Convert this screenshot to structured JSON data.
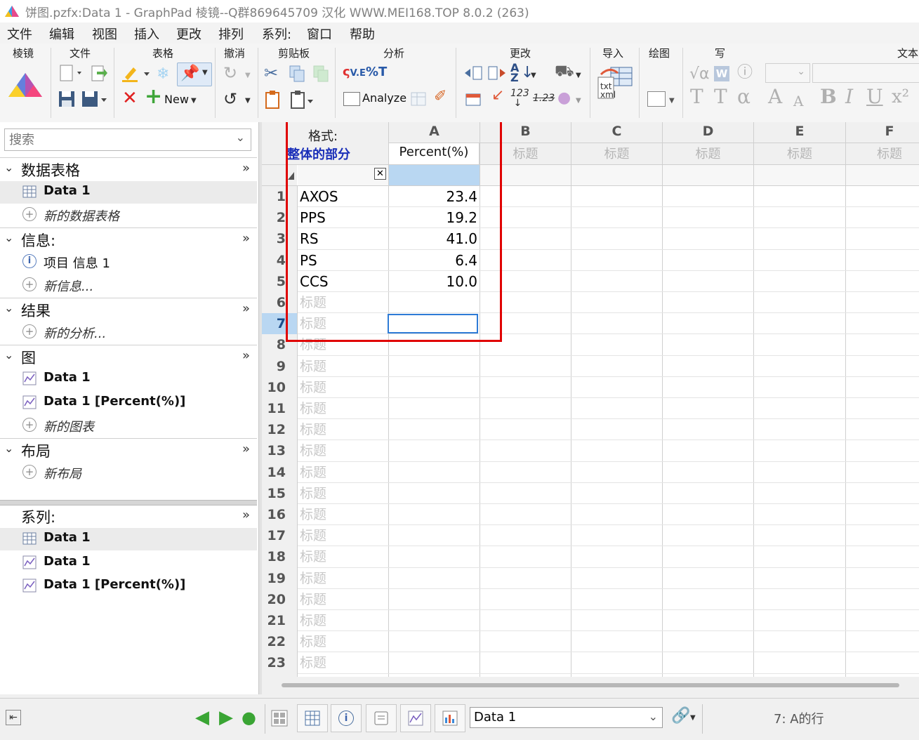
{
  "window": {
    "title": "饼图.pzfx:Data 1 - GraphPad 棱镜--Q群869645709 汉化 WWW.MEI168.TOP 8.0.2 (263)"
  },
  "menu": [
    "文件",
    "编辑",
    "视图",
    "插入",
    "更改",
    "排列",
    "系列:",
    "窗口",
    "帮助"
  ],
  "ribbon": {
    "groups": [
      "棱镜",
      "文件",
      "表格",
      "撤消",
      "剪贴板",
      "分析",
      "更改",
      "导入",
      "绘图",
      "写",
      "文本"
    ],
    "new_label": "New",
    "analyze_label": "Analyze",
    "import_label": "txt\nxml"
  },
  "navigator": {
    "search_placeholder": "搜索",
    "sections": {
      "data_tables": {
        "label": "数据表格",
        "items": [
          "Data 1"
        ],
        "new_label": "新的数据表格"
      },
      "info": {
        "label": "信息:",
        "items": [
          "项目 信息 1"
        ],
        "new_label": "新信息..."
      },
      "results": {
        "label": "结果",
        "new_label": "新的分析..."
      },
      "graphs": {
        "label": "图",
        "items": [
          "Data 1",
          "Data 1 [Percent(%)]"
        ],
        "new_label": "新的图表"
      },
      "layouts": {
        "label": "布局",
        "new_label": "新布局"
      },
      "family": {
        "label": "系列:",
        "items": [
          "Data 1",
          "Data 1",
          "Data 1 [Percent(%)]"
        ]
      }
    },
    "more_glyph": "»"
  },
  "sheet": {
    "format_label": "格式:",
    "format_value": "整体的部分",
    "columns": [
      "A",
      "B",
      "C",
      "D",
      "E",
      "F"
    ],
    "column_titles": [
      "Percent(%)",
      "标题",
      "标题",
      "标题",
      "标题",
      "标题"
    ],
    "rows": [
      {
        "n": "1",
        "title": "AXOS",
        "value": "23.4"
      },
      {
        "n": "2",
        "title": "PPS",
        "value": "19.2"
      },
      {
        "n": "3",
        "title": "RS",
        "value": "41.0"
      },
      {
        "n": "4",
        "title": "PS",
        "value": "6.4"
      },
      {
        "n": "5",
        "title": "CCS",
        "value": "10.0"
      },
      {
        "n": "6",
        "title": "标题",
        "value": ""
      },
      {
        "n": "7",
        "title": "标题",
        "value": ""
      },
      {
        "n": "8",
        "title": "标题",
        "value": ""
      },
      {
        "n": "9",
        "title": "标题",
        "value": ""
      },
      {
        "n": "10",
        "title": "标题",
        "value": ""
      },
      {
        "n": "11",
        "title": "标题",
        "value": ""
      },
      {
        "n": "12",
        "title": "标题",
        "value": ""
      },
      {
        "n": "13",
        "title": "标题",
        "value": ""
      },
      {
        "n": "14",
        "title": "标题",
        "value": ""
      },
      {
        "n": "15",
        "title": "标题",
        "value": ""
      },
      {
        "n": "16",
        "title": "标题",
        "value": ""
      },
      {
        "n": "17",
        "title": "标题",
        "value": ""
      },
      {
        "n": "18",
        "title": "标题",
        "value": ""
      },
      {
        "n": "19",
        "title": "标题",
        "value": ""
      },
      {
        "n": "20",
        "title": "标题",
        "value": ""
      },
      {
        "n": "21",
        "title": "标题",
        "value": ""
      },
      {
        "n": "22",
        "title": "标题",
        "value": ""
      },
      {
        "n": "23",
        "title": "标题",
        "value": ""
      }
    ],
    "selected_row": 7,
    "selection_color": "#2e7bd6",
    "highlight_color": "#e00000"
  },
  "bottom": {
    "sheet_select": "Data 1",
    "status": "7: A的行"
  }
}
